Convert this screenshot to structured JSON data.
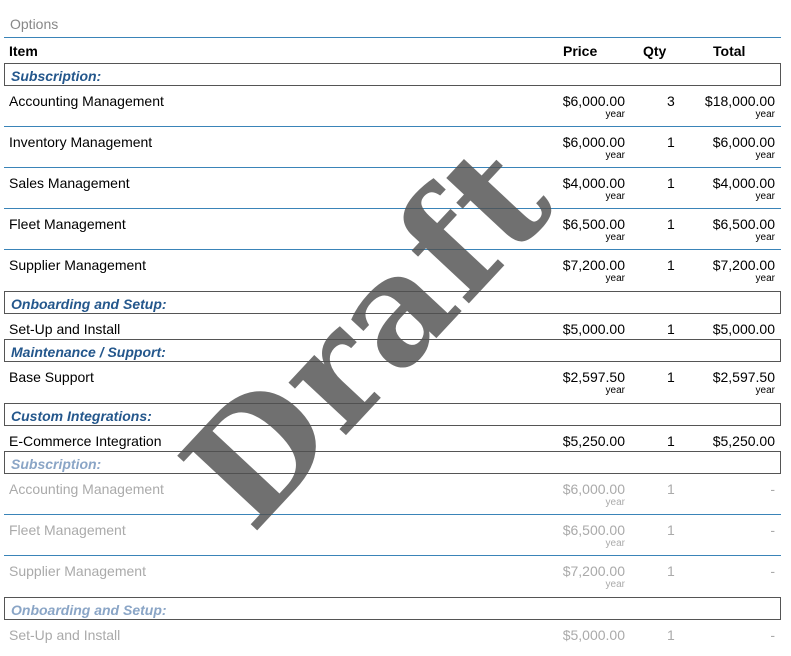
{
  "options_label": "Options",
  "headers": {
    "item": "Item",
    "price": "Price",
    "qty": "Qty",
    "total": "Total"
  },
  "watermark": "Draft",
  "rows": [
    {
      "kind": "category",
      "label": "Subscription:"
    },
    {
      "kind": "item",
      "name": "Accounting Management",
      "price": "$6,000.00",
      "price_unit": "year",
      "qty": "3",
      "total": "$18,000.00",
      "total_unit": "year"
    },
    {
      "kind": "item",
      "name": "Inventory Management",
      "price": "$6,000.00",
      "price_unit": "year",
      "qty": "1",
      "total": "$6,000.00",
      "total_unit": "year"
    },
    {
      "kind": "item",
      "name": "Sales Management",
      "price": "$4,000.00",
      "price_unit": "year",
      "qty": "1",
      "total": "$4,000.00",
      "total_unit": "year"
    },
    {
      "kind": "item",
      "name": "Fleet Management",
      "price": "$6,500.00",
      "price_unit": "year",
      "qty": "1",
      "total": "$6,500.00",
      "total_unit": "year"
    },
    {
      "kind": "item",
      "name": "Supplier Management",
      "price": "$7,200.00",
      "price_unit": "year",
      "qty": "1",
      "total": "$7,200.00",
      "total_unit": "year"
    },
    {
      "kind": "category",
      "label": "Onboarding and Setup:"
    },
    {
      "kind": "item",
      "name": "Set-Up and Install",
      "price": "$5,000.00",
      "qty": "1",
      "total": "$5,000.00"
    },
    {
      "kind": "category",
      "label": "Maintenance / Support:"
    },
    {
      "kind": "item",
      "name": "Base Support",
      "price": "$2,597.50",
      "price_unit": "year",
      "qty": "1",
      "total": "$2,597.50",
      "total_unit": "year"
    },
    {
      "kind": "category",
      "label": "Custom Integrations:"
    },
    {
      "kind": "item",
      "name": "E-Commerce Integration",
      "price": "$5,250.00",
      "qty": "1",
      "total": "$5,250.00"
    },
    {
      "kind": "category",
      "label": "Subscription:",
      "optional": true
    },
    {
      "kind": "item",
      "name": "Accounting Management",
      "price": "$6,000.00",
      "price_unit": "year",
      "qty": "1",
      "total": "-",
      "optional": true
    },
    {
      "kind": "item",
      "name": "Fleet Management",
      "price": "$6,500.00",
      "price_unit": "year",
      "qty": "1",
      "total": "-",
      "optional": true
    },
    {
      "kind": "item",
      "name": "Supplier Management",
      "price": "$7,200.00",
      "price_unit": "year",
      "qty": "1",
      "total": "-",
      "optional": true
    },
    {
      "kind": "category",
      "label": "Onboarding and Setup:",
      "optional": true
    },
    {
      "kind": "item",
      "name": "Set-Up and Install",
      "price": "$5,000.00",
      "qty": "1",
      "total": "-",
      "optional": true
    }
  ]
}
